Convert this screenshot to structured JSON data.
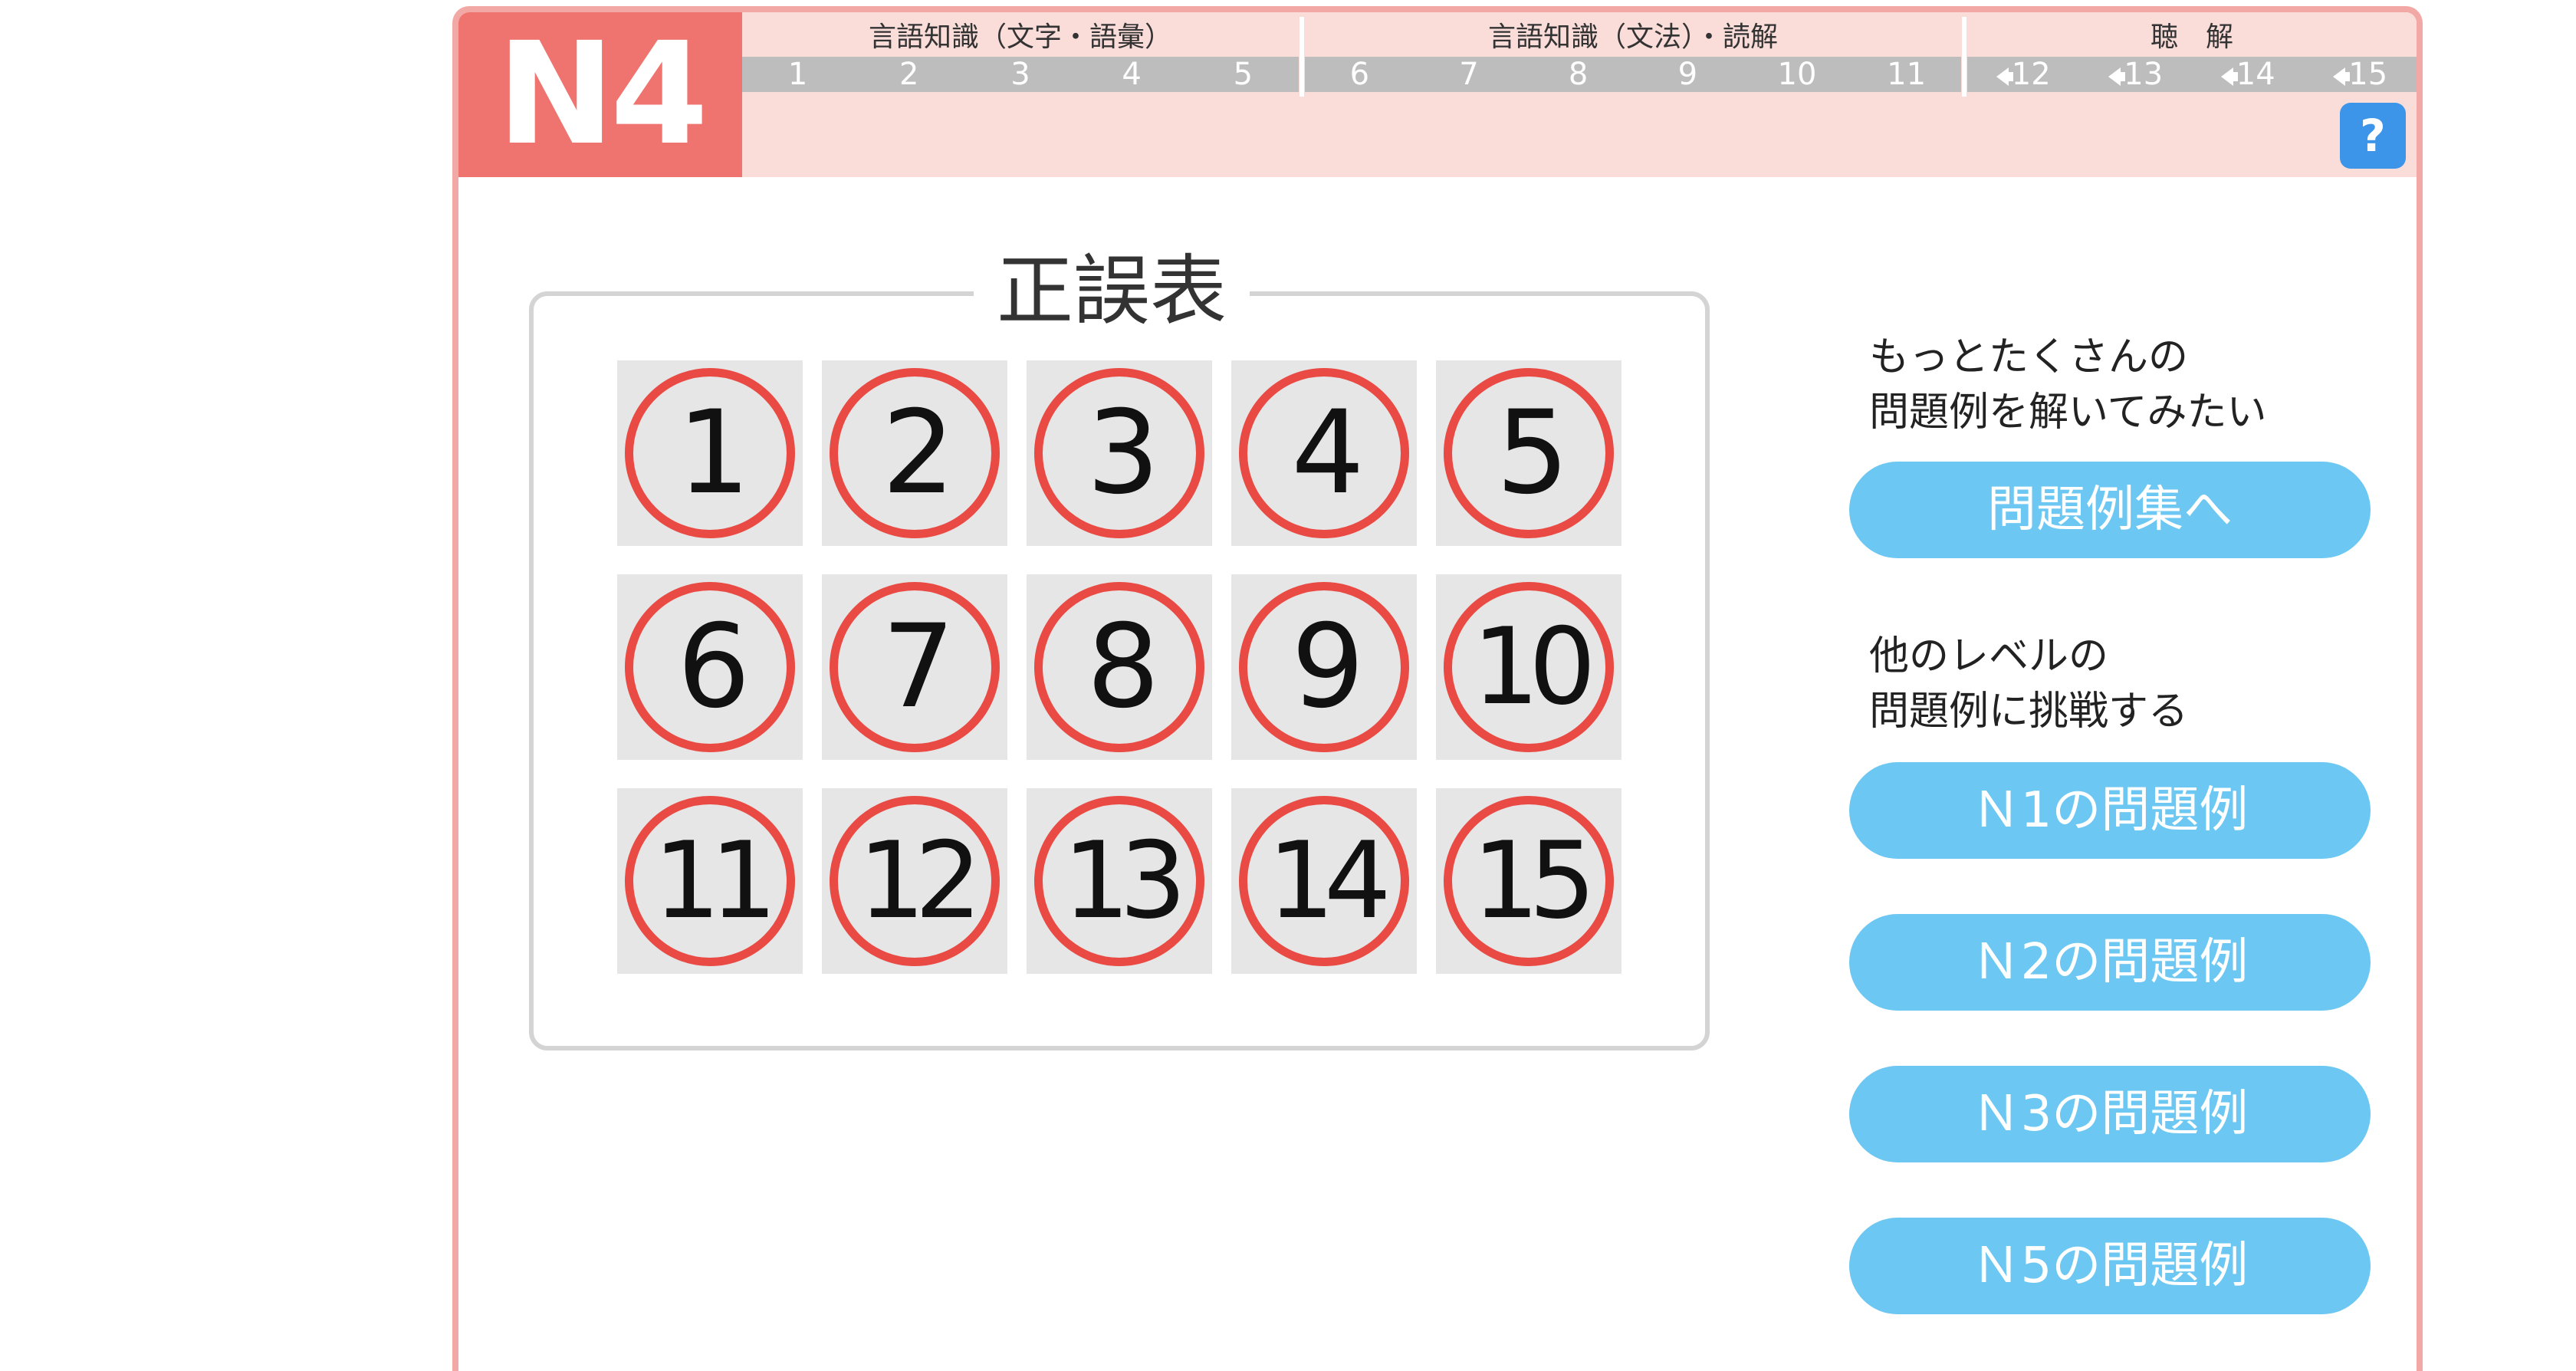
{
  "header": {
    "level": "N4",
    "sections": [
      {
        "title": "言語知識（文字・語彙）",
        "tabs": [
          "1",
          "2",
          "3",
          "4",
          "5"
        ]
      },
      {
        "title": "言語知識（文法）・読解",
        "tabs": [
          "6",
          "7",
          "8",
          "9",
          "10",
          "11"
        ]
      },
      {
        "title": "聴　解",
        "tabs": [
          "12",
          "13",
          "14",
          "15"
        ]
      }
    ],
    "help_label": "?"
  },
  "score_table": {
    "title": "正誤表",
    "items": [
      {
        "number": "1",
        "result": "correct"
      },
      {
        "number": "2",
        "result": "correct"
      },
      {
        "number": "3",
        "result": "correct"
      },
      {
        "number": "4",
        "result": "correct"
      },
      {
        "number": "5",
        "result": "correct"
      },
      {
        "number": "6",
        "result": "correct"
      },
      {
        "number": "7",
        "result": "correct"
      },
      {
        "number": "8",
        "result": "correct"
      },
      {
        "number": "9",
        "result": "correct"
      },
      {
        "number": "10",
        "result": "correct"
      },
      {
        "number": "11",
        "result": "correct"
      },
      {
        "number": "12",
        "result": "correct"
      },
      {
        "number": "13",
        "result": "correct"
      },
      {
        "number": "14",
        "result": "correct"
      },
      {
        "number": "15",
        "result": "correct"
      }
    ]
  },
  "side": {
    "more_text_line1": "もっとたくさんの",
    "more_text_line2": "問題例を解いてみたい",
    "collection_button": "問題例集へ",
    "other_text_line1": "他のレベルの",
    "other_text_line2": "問題例に挑戦する",
    "level_buttons": [
      "Ｎ1の問題例",
      "Ｎ2の問題例",
      "Ｎ3の問題例",
      "Ｎ5の問題例"
    ]
  },
  "colors": {
    "accent": "#ef7470",
    "header_bg": "#fadcd9",
    "tab_bg": "#bdbdbd",
    "correct_mark": "#e94a43",
    "button": "#6cc7f2",
    "help": "#3d95ea"
  }
}
